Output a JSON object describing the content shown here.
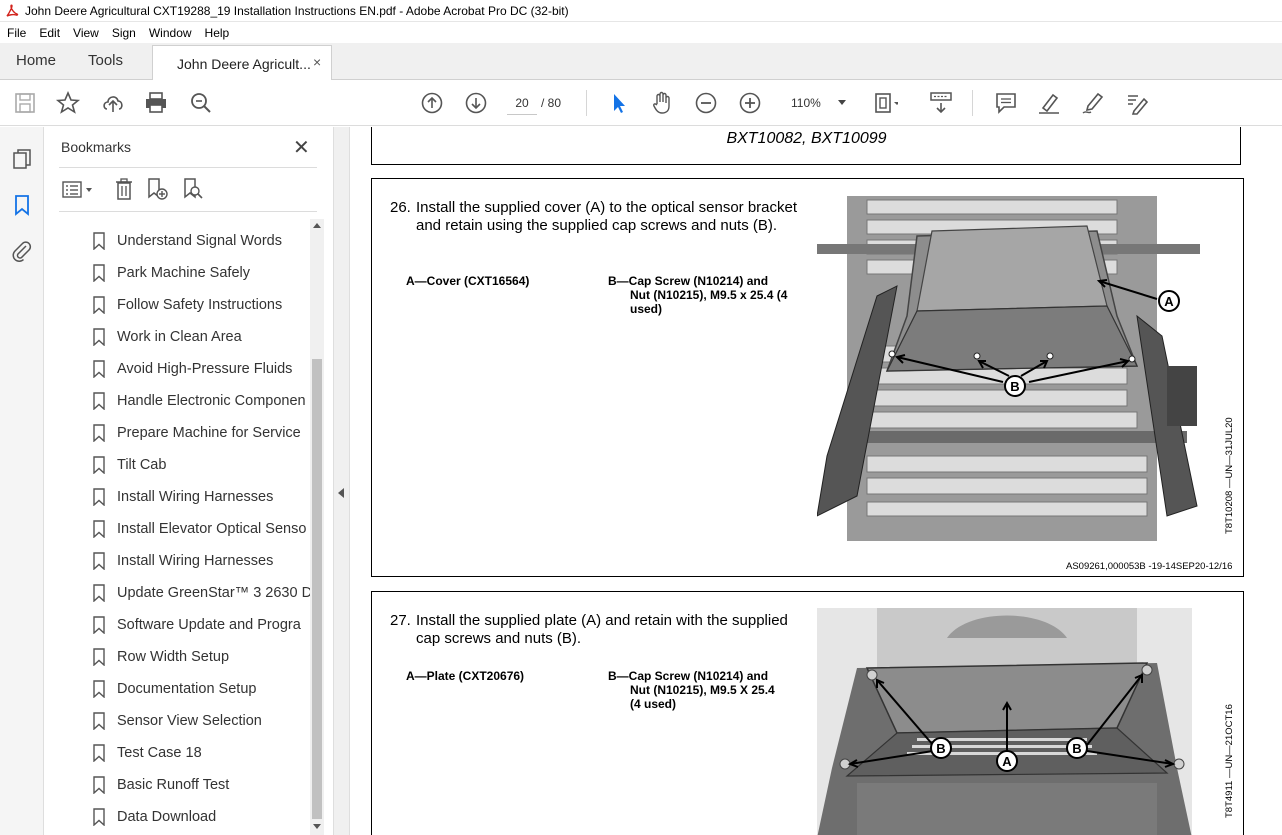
{
  "window": {
    "title": "John Deere Agricultural CXT19288_19 Installation Instructions EN.pdf - Adobe Acrobat Pro DC (32-bit)"
  },
  "menu": [
    "File",
    "Edit",
    "View",
    "Sign",
    "Window",
    "Help"
  ],
  "tabs": {
    "home": "Home",
    "tools": "Tools",
    "document": "John Deere Agricult...",
    "close": "×"
  },
  "toolbar": {
    "page_current": "20",
    "page_total": "/ 80",
    "zoom": "110%",
    "icons": [
      "save-icon",
      "star-icon",
      "upload-icon",
      "print-icon",
      "zoom-search-icon",
      "page-up-icon",
      "page-down-icon",
      "select-cursor-icon",
      "hand-icon",
      "zoom-out-icon",
      "zoom-in-icon",
      "page-fit-icon",
      "scroll-mode-icon",
      "comment-icon",
      "highlight-icon",
      "sign-icon",
      "edit-icon"
    ]
  },
  "bookmarks": {
    "title": "Bookmarks",
    "close": "✕",
    "items": [
      "Understand Signal Words",
      "Park Machine Safely",
      "Follow Safety Instructions",
      "Work in Clean Area",
      "Avoid High-Pressure Fluids",
      "Handle Electronic Componen",
      "Prepare Machine for Service",
      "Tilt Cab",
      "Install Wiring Harnesses",
      "Install Elevator Optical Senso",
      "Install Wiring Harnesses",
      "Update GreenStar™ 3 2630 D",
      "Software Update and Progra",
      "Row Width Setup",
      "Documentation Setup",
      "Sensor View Selection",
      "Test Case 18",
      "Basic Runoff Test",
      "Data Download"
    ]
  },
  "document": {
    "header_models": "BXT10082, BXT10099",
    "step26": {
      "number": "26.",
      "text": "Install the supplied cover (A) to the optical sensor bracket and retain using the supplied cap screws and nuts (B).",
      "legend_a": "A—Cover (CXT16564)",
      "legend_b_line1": "B—Cap Screw (N10214) and",
      "legend_b_line2": "Nut (N10215), M9.5 x 25.4 (4",
      "legend_b_line3": "used)",
      "figure_code": "T8T10208 —UN—31JUL20",
      "ref_code": "AS09261,000053B -19-14SEP20-12/16",
      "callout_a": "A",
      "callout_b": "B"
    },
    "step27": {
      "number": "27.",
      "text": "Install the supplied plate (A) and retain with the supplied cap screws and nuts (B).",
      "legend_a": "A—Plate (CXT20676)",
      "legend_b_line1": "B—Cap Screw (N10214) and",
      "legend_b_line2": "Nut (N10215), M9.5 X 25.4",
      "legend_b_line3": "(4 used)",
      "figure_code": "T8T4911 —UN—21OCT16",
      "callout_a": "A",
      "callout_b1": "B",
      "callout_b2": "B"
    }
  }
}
